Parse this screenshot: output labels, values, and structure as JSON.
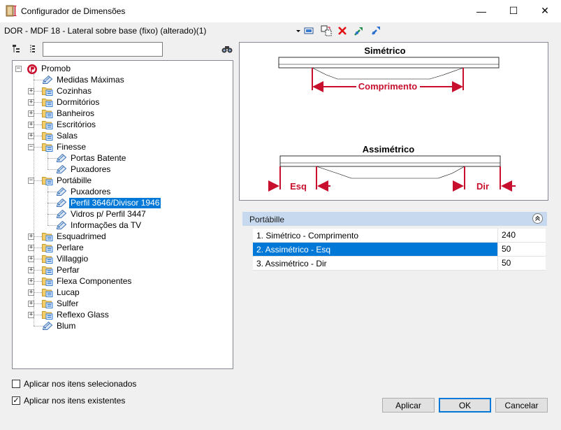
{
  "window": {
    "title": "Configurador de Dimensões",
    "minimize_glyph": "—",
    "maximize_glyph": "☐",
    "close_glyph": "✕"
  },
  "toolbar": {
    "document_title": "DOR - MDF 18 - Lateral sobre base (fixo) (alterado)(1)",
    "icons": [
      "dropdown-arrow-icon",
      "screen-select-icon",
      "copy-paste-icon",
      "delete-icon",
      "expand-green-icon",
      "collapse-blue-icon"
    ]
  },
  "search": {
    "placeholder": "",
    "value": ""
  },
  "tree": {
    "items": [
      {
        "label": "Promob",
        "level": 0,
        "type": "root",
        "expander": "−"
      },
      {
        "label": "Medidas Máximas",
        "level": 1,
        "type": "tag"
      },
      {
        "label": "Cozinhas",
        "level": 1,
        "type": "folder",
        "expander": "+"
      },
      {
        "label": "Dormitórios",
        "level": 1,
        "type": "folder",
        "expander": "+"
      },
      {
        "label": "Banheiros",
        "level": 1,
        "type": "folder",
        "expander": "+"
      },
      {
        "label": "Escritórios",
        "level": 1,
        "type": "folder",
        "expander": "+"
      },
      {
        "label": "Salas",
        "level": 1,
        "type": "folder",
        "expander": "+"
      },
      {
        "label": "Finesse",
        "level": 1,
        "type": "folder",
        "expander": "−"
      },
      {
        "label": "Portas Batente",
        "level": 2,
        "type": "tag"
      },
      {
        "label": "Puxadores",
        "level": 2,
        "type": "tag"
      },
      {
        "label": "Portábille",
        "level": 1,
        "type": "folder",
        "expander": "−"
      },
      {
        "label": "Puxadores",
        "level": 2,
        "type": "tag"
      },
      {
        "label": "Perfil 3646/Divisor 1946",
        "level": 2,
        "type": "tag",
        "selected": true
      },
      {
        "label": "Vidros p/ Perfil 3447",
        "level": 2,
        "type": "tag"
      },
      {
        "label": "Informações da TV",
        "level": 2,
        "type": "tag"
      },
      {
        "label": "Esquadrimed",
        "level": 1,
        "type": "folder",
        "expander": "+"
      },
      {
        "label": "Perlare",
        "level": 1,
        "type": "folder",
        "expander": "+"
      },
      {
        "label": "Villaggio",
        "level": 1,
        "type": "folder",
        "expander": "+"
      },
      {
        "label": "Perfar",
        "level": 1,
        "type": "folder",
        "expander": "+"
      },
      {
        "label": "Flexa Componentes",
        "level": 1,
        "type": "folder",
        "expander": "+"
      },
      {
        "label": "Lucap",
        "level": 1,
        "type": "folder",
        "expander": "+"
      },
      {
        "label": "Sulfer",
        "level": 1,
        "type": "folder",
        "expander": "+"
      },
      {
        "label": "Reflexo Glass",
        "level": 1,
        "type": "folder",
        "expander": "+"
      },
      {
        "label": "Blum",
        "level": 1,
        "type": "tag"
      }
    ]
  },
  "diagram": {
    "symmetric_title": "Simétrico",
    "symmetric_dim": "Comprimento",
    "asymmetric_title": "Assimétrico",
    "left_dim": "Esq",
    "right_dim": "Dir",
    "accent_color": "#c8102e"
  },
  "properties": {
    "group_title": "Portábille",
    "collapse_glyph": "«",
    "rows": [
      {
        "name": "1. Simétrico - Comprimento",
        "value": "240",
        "selected": false
      },
      {
        "name": "2. Assimétrico - Esq",
        "value": "50",
        "selected": true
      },
      {
        "name": "3. Assimétrico - Dir",
        "value": "50",
        "selected": false
      }
    ]
  },
  "options": {
    "apply_selected_label": "Aplicar nos itens selecionados",
    "apply_selected_checked": false,
    "apply_existing_label": "Aplicar nos itens existentes",
    "apply_existing_checked": true,
    "check_glyph": "✓"
  },
  "buttons": {
    "apply": "Aplicar",
    "ok": "OK",
    "cancel": "Cancelar"
  }
}
